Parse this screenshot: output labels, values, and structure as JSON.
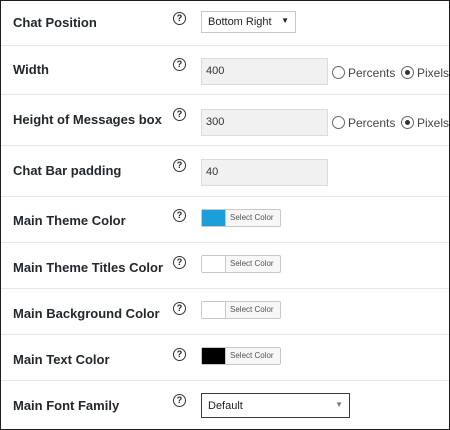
{
  "settings": {
    "chat_position": {
      "label": "Chat Position",
      "value": "Bottom Right",
      "arrow": "▼"
    },
    "width": {
      "label": "Width",
      "value": "400",
      "unit_options": [
        "Percents",
        "Pixels"
      ],
      "selected_unit": "Pixels"
    },
    "height": {
      "label": "Height of Messages box",
      "value": "300",
      "unit_options": [
        "Percents",
        "Pixels"
      ],
      "selected_unit": "Pixels"
    },
    "padding": {
      "label": "Chat Bar padding",
      "value": "40"
    },
    "main_theme_color": {
      "label": "Main Theme Color",
      "swatch": "#1a9fd9",
      "button_label": "Select Color"
    },
    "main_theme_titles_color": {
      "label": "Main Theme Titles Color",
      "swatch": "#ffffff",
      "button_label": "Select Color"
    },
    "main_background_color": {
      "label": "Main Background Color",
      "swatch": "#ffffff",
      "button_label": "Select Color"
    },
    "main_text_color": {
      "label": "Main Text Color",
      "swatch": "#000000",
      "button_label": "Select Color"
    },
    "main_font_family": {
      "label": "Main Font Family",
      "value": "Default",
      "arrow": "▼"
    }
  },
  "help_icon": {
    "glyph": "?"
  }
}
